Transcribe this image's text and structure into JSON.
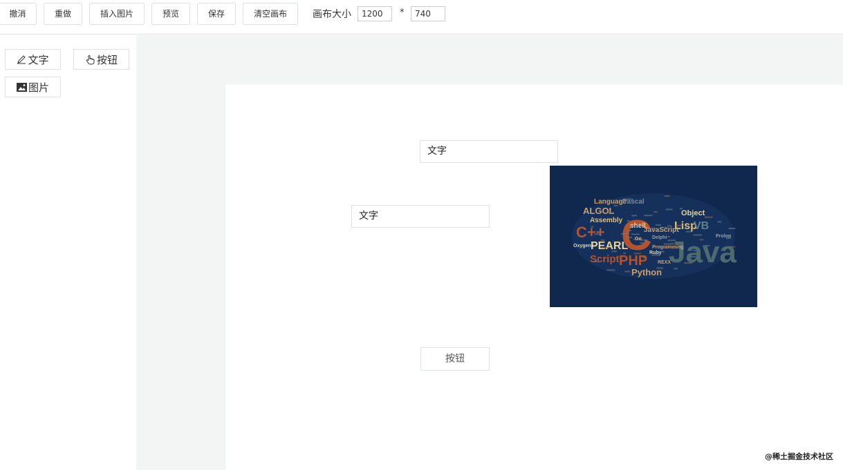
{
  "toolbar": {
    "undo": "撤消",
    "redo": "重做",
    "insert_image": "插入图片",
    "preview": "预览",
    "save": "保存",
    "clear_canvas": "清空画布",
    "canvas_size_label": "画布大小",
    "canvas_width": "1200",
    "canvas_height": "740",
    "times_sign": "*"
  },
  "sidebar": {
    "text_component": "文字",
    "button_component": "按钮",
    "image_component": "图片"
  },
  "canvas": {
    "text1": "文字",
    "text2": "文字",
    "button": "按钮",
    "word_cloud": [
      "Language",
      "Pascal",
      "ALGOL",
      "Assembly",
      "C",
      "C++",
      "PEARL",
      "PHP",
      "Script",
      "Python",
      "Lisp",
      "VB",
      "Object",
      "Java",
      "JavaScript",
      "shell",
      "Delphi",
      "Ruby",
      "Go",
      "Prolog",
      "REXX",
      "Oxygene",
      "Programming"
    ]
  },
  "watermark": "@稀土掘金技术社区",
  "colors": {
    "border": "#dcdfe6",
    "workspace_bg": "#f3f4f4",
    "image_bg": "#10284e"
  }
}
